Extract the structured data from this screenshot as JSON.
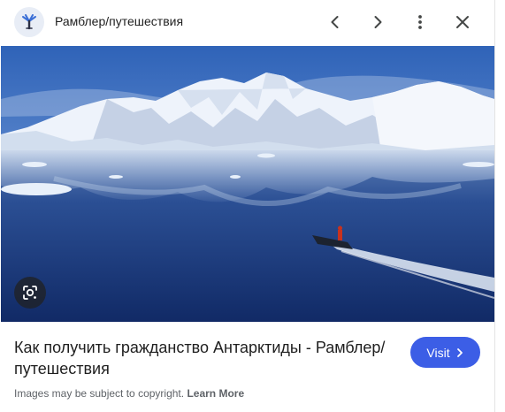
{
  "header": {
    "site_name": "Рамблер/путешествия",
    "logo_icon": "rambler-travel-logo-icon",
    "buttons": [
      "chevron-left-icon",
      "chevron-right-icon",
      "more-vert-icon",
      "close-icon"
    ]
  },
  "image": {
    "subject": "antarctic-bay-with-boat",
    "lens_icon": "google-lens-icon"
  },
  "result": {
    "title": "Как получить гражданство Антарктиды - Рамблер/путешествия",
    "visit_label": "Visit"
  },
  "footer": {
    "notice": "Images may be subject to copyright.",
    "learn_more": "Learn More"
  },
  "colors": {
    "accent": "#3c5ee6",
    "text": "#1f1f1f",
    "muted": "#5f6368"
  }
}
